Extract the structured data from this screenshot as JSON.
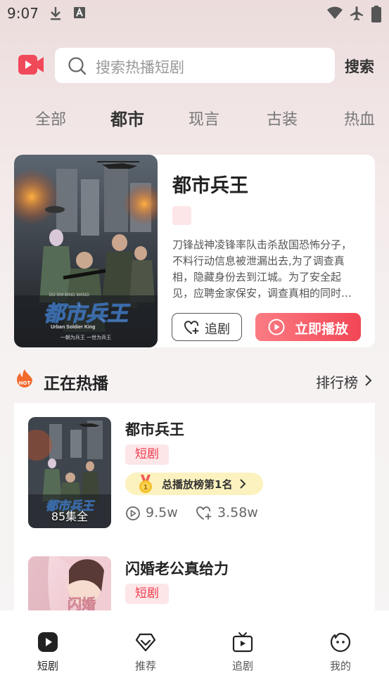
{
  "status_bar": {
    "time": "9:07"
  },
  "search": {
    "placeholder": "搜索热播短剧",
    "button_label": "搜索"
  },
  "category_tabs": [
    "全部",
    "都市",
    "现言",
    "古装",
    "热血"
  ],
  "active_tab_index": 1,
  "featured": {
    "title": "都市兵王",
    "description": "刀锋战神凌锋率队击杀敌国恐怖分子，不料行动信息被泄漏出去,为了调查真相，隐藏身份去到江城。为了安全起见，应聘金家保安，调查真相的同时…",
    "poster_title": "都市兵王",
    "poster_subtitle": "Urban Soldier King",
    "poster_pinyin": "DU SHI BING WANG",
    "poster_tagline": "一朝为兵王 一世为兵王",
    "follow_label": "追剧",
    "play_label": "立即播放"
  },
  "hot_section": {
    "badge": "HOT",
    "title": "正在热播",
    "ranking_label": "排行榜"
  },
  "drama_list": [
    {
      "title": "都市兵王",
      "tag": "短剧",
      "episodes": "85集全",
      "poster_title": "都市兵王",
      "rank_label": "总播放榜第1名",
      "rank_number": "1",
      "plays": "9.5w",
      "likes": "3.58w"
    },
    {
      "title": "闪婚老公真给力",
      "tag": "短剧",
      "poster_title": "闪婚"
    }
  ],
  "bottom_nav": [
    {
      "label": "短剧",
      "icon": "play-icon",
      "active": true
    },
    {
      "label": "推荐",
      "icon": "recommend-heart-icon",
      "active": false
    },
    {
      "label": "追剧",
      "icon": "tv-icon",
      "active": false
    },
    {
      "label": "我的",
      "icon": "face-icon",
      "active": false
    }
  ],
  "colors": {
    "accent": "#f34655",
    "tag_bg": "#fde6e8",
    "rank_bg": "#fcf2bf"
  }
}
